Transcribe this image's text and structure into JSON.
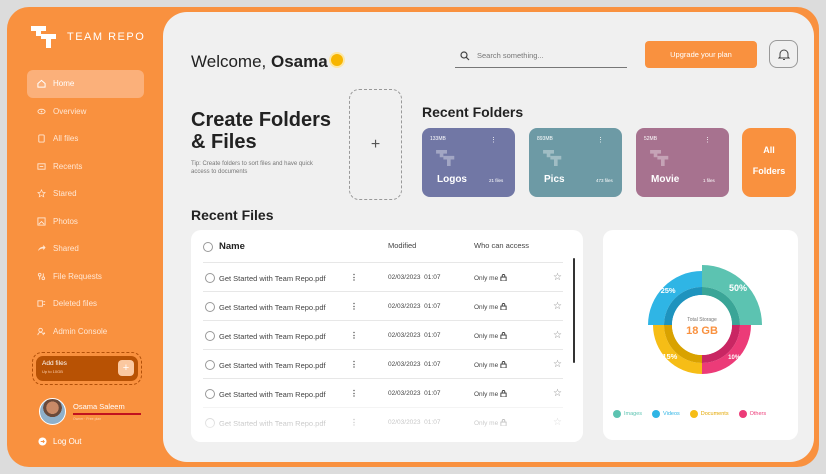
{
  "brand": {
    "name": "TEAM REPO"
  },
  "sidebar": {
    "items": [
      {
        "label": "Home",
        "icon": "home-icon",
        "active": true
      },
      {
        "label": "Overview",
        "icon": "eye-icon"
      },
      {
        "label": "All files",
        "icon": "files-icon"
      },
      {
        "label": "Recents",
        "icon": "recents-icon"
      },
      {
        "label": "Stared",
        "icon": "star-icon"
      },
      {
        "label": "Photos",
        "icon": "photo-icon"
      },
      {
        "label": "Shared",
        "icon": "share-icon"
      },
      {
        "label": "File Requests",
        "icon": "file-request-icon"
      },
      {
        "label": "Deleted files",
        "icon": "trash-icon"
      },
      {
        "label": "Admin Console",
        "icon": "admin-icon"
      }
    ],
    "add_files": {
      "title": "Add files",
      "subtitle": "Up to 10GB"
    },
    "user": {
      "name": "Osama Saleem",
      "subtitle": "Owner · Free plan"
    },
    "logout": "Log Out"
  },
  "header": {
    "welcome": "Welcome,",
    "user": "Osama",
    "search_placeholder": "Search something...",
    "upgrade": "Upgrade your plan"
  },
  "create": {
    "title1": "Create Folders",
    "title2": "& Files",
    "tip": "Tip: Create folders to sort files and have quick access to documents",
    "plus": "+"
  },
  "recent_folders": {
    "title": "Recent Folders",
    "items": [
      {
        "name": "Logos",
        "size": "133MB",
        "count": "21 files",
        "color": "#7177a5"
      },
      {
        "name": "Pics",
        "size": "893MB",
        "count": "473 files",
        "color": "#6d9aa5"
      },
      {
        "name": "Movie",
        "size": "52MB",
        "count": "1 files",
        "color": "#a7728f"
      }
    ],
    "all1": "All",
    "all2": "Folders"
  },
  "recent_files": {
    "title": "Recent Files",
    "columns": {
      "name": "Name",
      "modified": "Modified",
      "who": "Who can access"
    },
    "rows": [
      {
        "name": "Get Started with Team Repo.pdf",
        "date": "02/03/2023",
        "time": "01:07",
        "who": "Only me"
      },
      {
        "name": "Get Started with Team Repo.pdf",
        "date": "02/03/2023",
        "time": "01:07",
        "who": "Only me"
      },
      {
        "name": "Get Started with Team Repo.pdf",
        "date": "02/03/2023",
        "time": "01:07",
        "who": "Only me"
      },
      {
        "name": "Get Started with Team Repo.pdf",
        "date": "02/03/2023",
        "time": "01:07",
        "who": "Only me"
      },
      {
        "name": "Get Started with Team Repo.pdf",
        "date": "02/03/2023",
        "time": "01:07",
        "who": "Only me"
      },
      {
        "name": "Get Started with Team Repo.pdf",
        "date": "02/03/2023",
        "time": "01:07",
        "who": "Only me"
      }
    ]
  },
  "storage": {
    "label": "Total Storage",
    "value": "18 GB",
    "segments": [
      {
        "name": "Images",
        "percent": "50%",
        "color": "#5cc3b1"
      },
      {
        "name": "Videos",
        "percent": "25%",
        "color": "#2fb5e5"
      },
      {
        "name": "Documents",
        "percent": "15%",
        "color": "#f6bd16"
      },
      {
        "name": "Others",
        "percent": "10%",
        "color": "#ec3b78"
      }
    ]
  },
  "colors": {
    "accent": "#f9913f",
    "panel": "#f0f0f0"
  }
}
